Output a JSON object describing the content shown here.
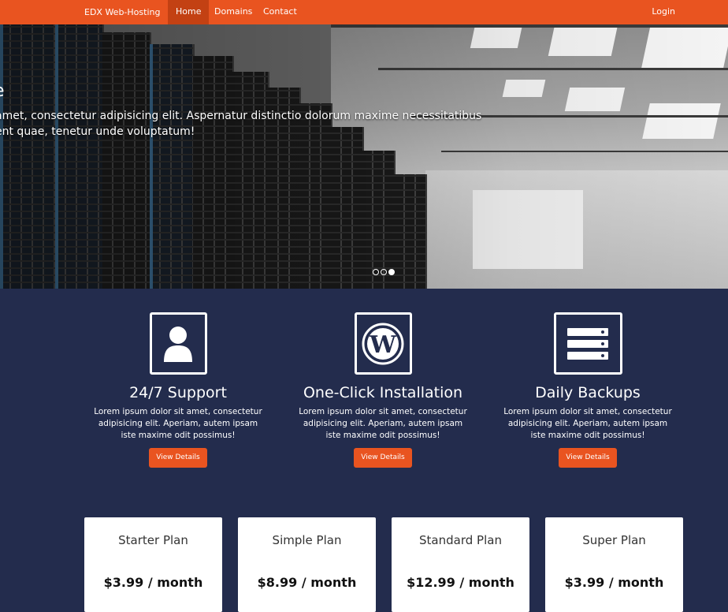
{
  "nav": {
    "brand": "EDX Web-Hosting",
    "items": [
      {
        "label": "Home"
      },
      {
        "label": "Domains"
      },
      {
        "label": "Contact"
      }
    ],
    "login": "Login"
  },
  "hero": {
    "title": "e",
    "text_lines": [
      "amet, consectetur adipisicing elit. Aspernatur distinctio dolorum maxime necessitatibus",
      "ent quae, tenetur unde voluptatum!"
    ],
    "slides_total": 3,
    "active_slide": 3
  },
  "features": [
    {
      "icon": "user-icon",
      "title": "24/7 Support",
      "desc": "Lorem ipsum dolor sit amet, consectetur adipisicing elit. Aperiam, autem ipsam iste maxime odit possimus!",
      "button": "View Details"
    },
    {
      "icon": "wordpress-icon",
      "title": "One-Click Installation",
      "desc": "Lorem ipsum dolor sit amet, consectetur adipisicing elit. Aperiam, autem ipsam iste maxime odit possimus!",
      "button": "View Details"
    },
    {
      "icon": "server-icon",
      "title": "Daily Backups",
      "desc": "Lorem ipsum dolor sit amet, consectetur adipisicing elit. Aperiam, autem ipsam iste maxime odit possimus!",
      "button": "View Details"
    }
  ],
  "plans": [
    {
      "name": "Starter Plan",
      "price": "$3.99 / month"
    },
    {
      "name": "Simple Plan",
      "price": "$8.99 / month"
    },
    {
      "name": "Standard Plan",
      "price": "$12.99 / month"
    },
    {
      "name": "Super Plan",
      "price": "$3.99 / month"
    }
  ],
  "colors": {
    "accent": "#e95420",
    "active_nav": "#c34113",
    "background": "#232c4d"
  }
}
